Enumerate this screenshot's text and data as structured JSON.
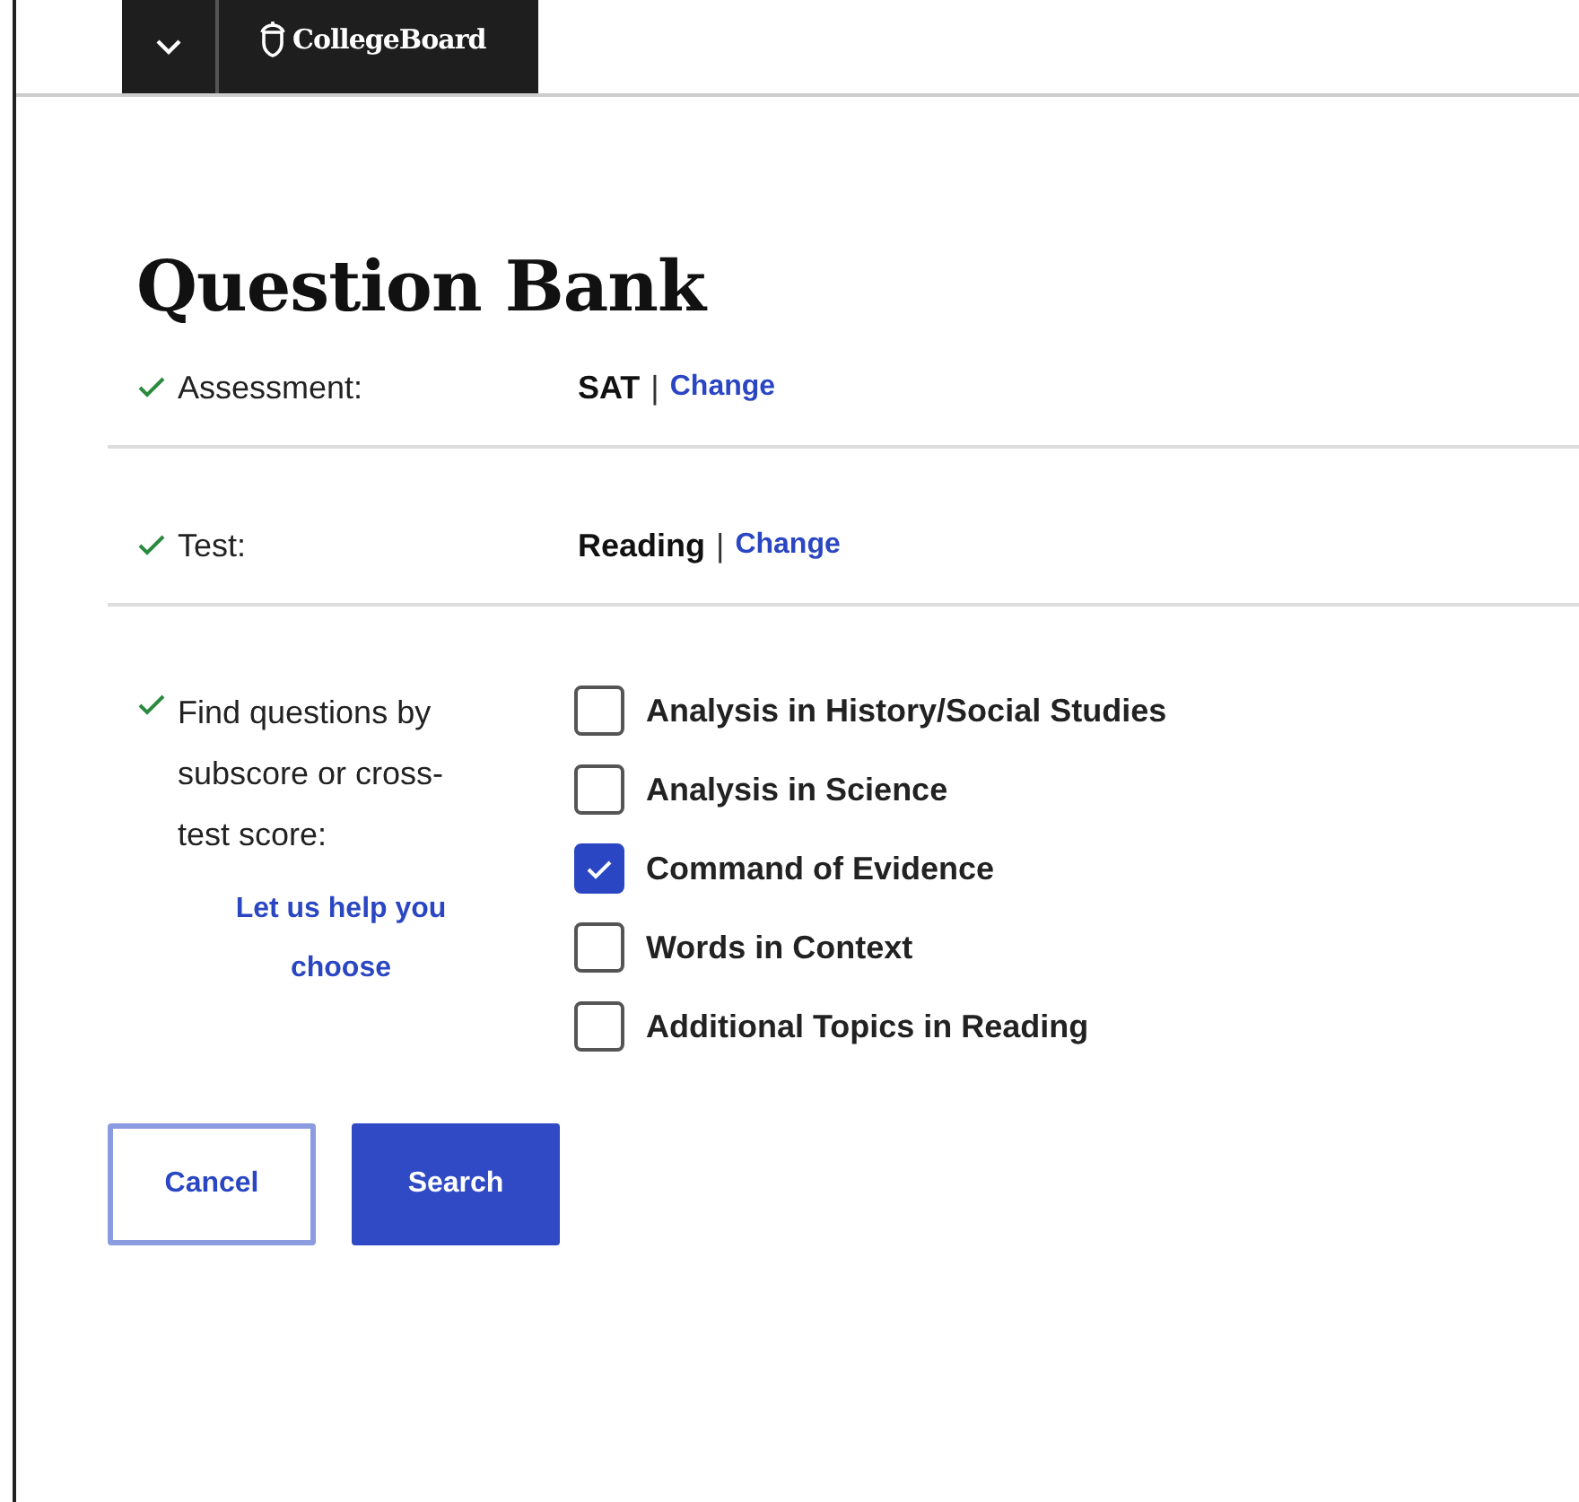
{
  "header": {
    "brand": "CollegeBoard"
  },
  "title": "Question Bank",
  "steps": [
    {
      "label": "Assessment:",
      "completed": true,
      "value": "SAT",
      "separator": "|",
      "link": "Change"
    },
    {
      "label": "Test:",
      "completed": true,
      "value": "Reading",
      "separator": "|",
      "link": "Change"
    }
  ],
  "filter": {
    "label": "Find questions by subscore or cross-test score:",
    "completed": true,
    "help_link": "Let us help you choose",
    "options": [
      {
        "label": "Analysis in History/Social Studies",
        "checked": false
      },
      {
        "label": "Analysis in Science",
        "checked": false
      },
      {
        "label": "Command of Evidence",
        "checked": true
      },
      {
        "label": "Words in Context",
        "checked": false
      },
      {
        "label": "Additional Topics in Reading",
        "checked": false
      }
    ]
  },
  "buttons": [
    {
      "label": "Cancel",
      "kind": "secondary"
    },
    {
      "label": "Search",
      "kind": "primary"
    }
  ]
}
